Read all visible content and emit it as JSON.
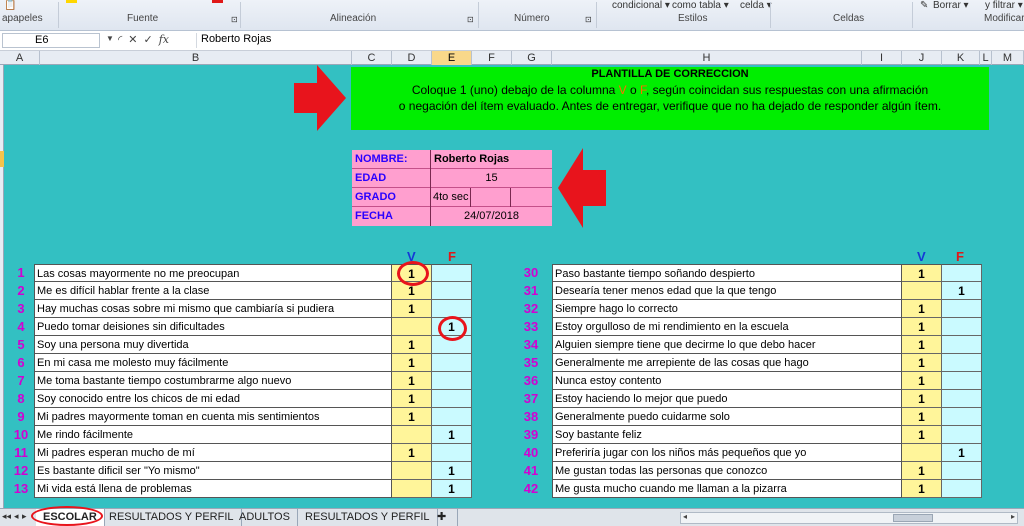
{
  "ribbon": {
    "left_label": "apapeles",
    "groups": [
      "Fuente",
      "Alineación",
      "Número",
      "Estilos",
      "Celdas",
      "Modificar"
    ],
    "style_buttons": [
      "condicional ▾",
      "como tabla ▾",
      "celda ▾"
    ],
    "borrar_label": "Borrar ▾",
    "filtrar_label": "y filtrar ▾"
  },
  "formula_bar": {
    "name_box": "E6",
    "fx_label": "fx",
    "formula": "Roberto Rojas"
  },
  "columns": [
    "A",
    "B",
    "C",
    "D",
    "E",
    "F",
    "G",
    "H",
    "I",
    "J",
    "K",
    "L",
    "M"
  ],
  "selected_column": "E",
  "banner": {
    "title": "PLANTILLA DE CORRECCION",
    "line1_a": "Coloque  1 (uno) debajo de la columna ",
    "line1_v": "V",
    "line1_o": " o ",
    "line1_f": "F",
    "line1_b": ", según coincidan sus respuestas con una afirmación",
    "line2": "o negación del ítem evaluado. Antes de entregar, verifique que no ha dejado de responder algún ítem."
  },
  "info": {
    "nombre_label": "NOMBRE:",
    "nombre": "Roberto Rojas",
    "edad_label": "EDAD",
    "edad": "15",
    "grado_label": "GRADO",
    "grado": "4to sec",
    "fecha_label": "FECHA",
    "fecha": "24/07/2018"
  },
  "headers": {
    "v": "V",
    "f": "F"
  },
  "left_items": [
    {
      "n": "1",
      "text": "Las cosas mayormente no me preocupan",
      "v": "1",
      "f": ""
    },
    {
      "n": "2",
      "text": "Me es difícil hablar frente a la clase",
      "v": "1",
      "f": ""
    },
    {
      "n": "3",
      "text": "Hay muchas cosas sobre mi mismo que cambiaría si pudiera",
      "v": "1",
      "f": ""
    },
    {
      "n": "4",
      "text": "Puedo tomar deisiones sin dificultades",
      "v": "",
      "f": "1"
    },
    {
      "n": "5",
      "text": "Soy una persona muy divertida",
      "v": "1",
      "f": ""
    },
    {
      "n": "6",
      "text": "En mi casa me molesto muy fácilmente",
      "v": "1",
      "f": ""
    },
    {
      "n": "7",
      "text": "Me toma bastante tiempo costumbrarme  algo nuevo",
      "v": "1",
      "f": ""
    },
    {
      "n": "8",
      "text": "Soy conocido entre los chicos de mi edad",
      "v": "1",
      "f": ""
    },
    {
      "n": "9",
      "text": "Mi padres mayormente toman en cuenta mis sentimientos",
      "v": "1",
      "f": ""
    },
    {
      "n": "10",
      "text": "Me rindo fácilmente",
      "v": "",
      "f": "1"
    },
    {
      "n": "11",
      "text": "Mi padres esperan mucho de mí",
      "v": "1",
      "f": ""
    },
    {
      "n": "12",
      "text": "Es bastante dificil ser \"Yo mismo\"",
      "v": "",
      "f": "1"
    },
    {
      "n": "13",
      "text": "Mi vida está llena de problemas",
      "v": "",
      "f": "1"
    }
  ],
  "right_items": [
    {
      "n": "30",
      "text": "Paso bastante tiempo soñando despierto",
      "v": "1",
      "f": ""
    },
    {
      "n": "31",
      "text": "Desearía tener menos edad que la que tengo",
      "v": "",
      "f": "1"
    },
    {
      "n": "32",
      "text": "Siempre hago lo correcto",
      "v": "1",
      "f": ""
    },
    {
      "n": "33",
      "text": "Estoy orgulloso de mi rendimiento en la escuela",
      "v": "1",
      "f": ""
    },
    {
      "n": "34",
      "text": "Alguien siempre tiene que decirme lo que debo hacer",
      "v": "1",
      "f": ""
    },
    {
      "n": "35",
      "text": "Generalmente me arrepiente de las cosas que hago",
      "v": "1",
      "f": ""
    },
    {
      "n": "36",
      "text": "Nunca estoy contento",
      "v": "1",
      "f": ""
    },
    {
      "n": "37",
      "text": "Estoy haciendo lo mejor que puedo",
      "v": "1",
      "f": ""
    },
    {
      "n": "38",
      "text": "Generalmente puedo cuidarme solo",
      "v": "1",
      "f": ""
    },
    {
      "n": "39",
      "text": "Soy bastante feliz",
      "v": "1",
      "f": ""
    },
    {
      "n": "40",
      "text": "Preferiría jugar con los niños más pequeños que yo",
      "v": "",
      "f": "1"
    },
    {
      "n": "41",
      "text": "Me gustan todas las personas que conozco",
      "v": "1",
      "f": ""
    },
    {
      "n": "42",
      "text": "Me gusta mucho cuando me llaman a la pizarra",
      "v": "1",
      "f": ""
    }
  ],
  "tabs": [
    "ESCOLAR",
    "RESULTADOS Y PERFIL",
    "ADULTOS",
    "RESULTADOS Y  PERFIL"
  ],
  "colors": {
    "sheet_bg": "#33c0c2",
    "banner_bg": "#00ee00",
    "info_bg": "#ff9fcf",
    "v_col": "#fff59a",
    "f_col": "#cafaff",
    "item_number": "#d200d2",
    "arrow": "#e8141c"
  }
}
